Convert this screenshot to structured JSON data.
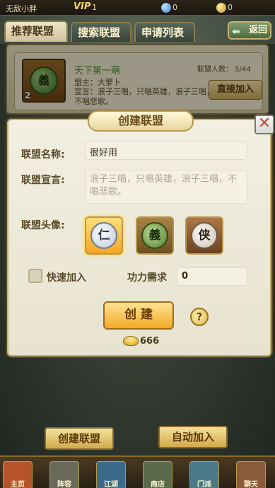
{
  "topbar": {
    "player_name": "无敌小胖",
    "vip_label": "VIP",
    "vip_level": "1",
    "gem_count": "0",
    "gold_count": "0"
  },
  "tabs": [
    {
      "label": "推荐联盟",
      "active": true
    },
    {
      "label": "搜索联盟",
      "active": false
    },
    {
      "label": "申请列表",
      "active": false
    }
  ],
  "back_label": "返回",
  "alliance_card": {
    "name": "天下第一萌",
    "level": "2",
    "emblem_glyph": "義",
    "leader": "盟主：大萝卜",
    "declaration": "宣言：浪子三唱，只唱英雄，浪子三唱，不唱悲歌。",
    "member_count": "联盟人数： 5/44",
    "join_label": "直接加入"
  },
  "modal": {
    "title": "创建联盟",
    "close_glyph": "✕",
    "name_label": "联盟名称:",
    "name_value": "很好用",
    "declaration_label": "联盟宣言:",
    "declaration_placeholder": "浪子三唱，只唱英雄，浪子三唱，不唱悲歌。",
    "emblem_label": "联盟头像:",
    "emblems": [
      {
        "glyph": "仁",
        "selected": true
      },
      {
        "glyph": "義",
        "selected": false
      },
      {
        "glyph": "侠",
        "selected": false
      }
    ],
    "quick_join_label": "快速加入",
    "quick_join_checked": false,
    "power_label": "功力需求",
    "power_value": "0",
    "create_label": "创  建",
    "help_glyph": "?",
    "cost": "666"
  },
  "bottom_buttons": {
    "create": "创建联盟",
    "auto_join": "自动加入"
  },
  "bottom_nav": [
    "主页",
    "阵容",
    "江湖",
    "商店",
    "门派",
    "聊天"
  ],
  "colors": {
    "accent_gold": "#f0a926",
    "title_green": "#4a8a2c",
    "close_red": "#c84a2b"
  }
}
